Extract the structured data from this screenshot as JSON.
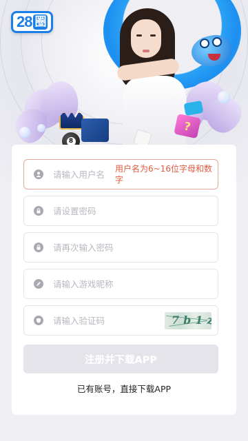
{
  "header": {
    "logo_number": "28",
    "logo_char": "圈"
  },
  "banner": {
    "ball_number": "8",
    "cube_mark": "?"
  },
  "form": {
    "username": {
      "placeholder": "请输入用户名",
      "value": "",
      "error": "用户名为6~16位字母和数字",
      "icon": "user-icon"
    },
    "password": {
      "placeholder": "请设置密码",
      "value": "",
      "icon": "lock-icon"
    },
    "confirm_password": {
      "placeholder": "请再次输入密码",
      "value": "",
      "icon": "lock-icon"
    },
    "nickname": {
      "placeholder": "请输入游戏昵称",
      "value": "",
      "icon": "pen-icon"
    },
    "captcha": {
      "placeholder": "请输入验证码",
      "value": "",
      "icon": "shield-icon",
      "image_text": "7b1z"
    },
    "submit_label": "注册并下载APP",
    "login_link": "已有账号，直接下载APP"
  },
  "colors": {
    "accent_blue": "#1a7ee8",
    "error": "#e05a3f",
    "button_disabled": "#e4e4ea",
    "page_bg": "#eeeef3"
  }
}
